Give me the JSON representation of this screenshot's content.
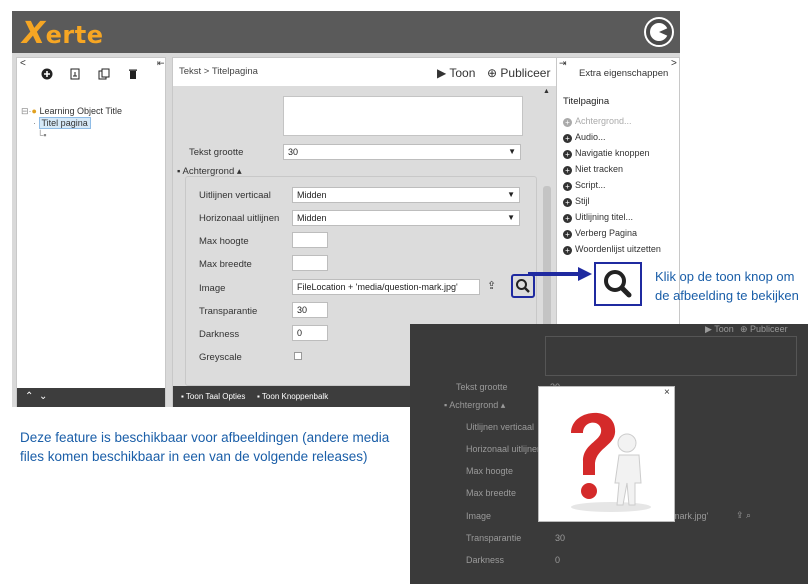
{
  "app": {
    "logo_text": "erte",
    "logo_x": "X",
    "left_toolbar": [
      "+",
      "⎗",
      "⎘",
      "🗑"
    ],
    "tree": {
      "root": "Learning Object Title",
      "selected": "Titel pagina"
    },
    "breadcrumb": "Tekst > Titelpagina",
    "toon": "Toon",
    "publiceer": "Publiceer",
    "tekst_grootte_label": "Tekst grootte",
    "tekst_grootte_value": "30",
    "group_label": "Achtergrond",
    "fields": {
      "uitlijnen_verticaal": {
        "label": "Uitlijnen verticaal",
        "value": "Midden"
      },
      "horizonaal_uitlijnen": {
        "label": "Horizonaal uitlijnen",
        "value": "Midden"
      },
      "max_hoogte": {
        "label": "Max hoogte",
        "value": ""
      },
      "max_breedte": {
        "label": "Max breedte",
        "value": ""
      },
      "image": {
        "label": "Image",
        "value": "FileLocation + 'media/question-mark.jpg'"
      },
      "transparantie": {
        "label": "Transparantie",
        "value": "30"
      },
      "darkness": {
        "label": "Darkness",
        "value": "0"
      },
      "greyscale": {
        "label": "Greyscale"
      }
    },
    "footer": {
      "taal": "Toon Taal Opties",
      "knoppen": "Toon Knoppenbalk"
    },
    "right_panel": {
      "title": "Extra eigenschappen",
      "section": "Titelpagina",
      "props": [
        "Achtergrond...",
        "Audio...",
        "Navigatie knoppen",
        "Niet tracken",
        "Script...",
        "Stijl",
        "Uitlijning titel...",
        "Verberg Pagina",
        "Woordenlijst uitzetten"
      ]
    }
  },
  "annotations": {
    "callout": "Klik op de toon knop om de afbeelding te bekijken",
    "note": "Deze feature is beschikbaar voor afbeeldingen (andere media files komen beschikbaar in een van de volgende releases)"
  },
  "overlay": {
    "toon": "Toon",
    "publiceer": "Publiceer",
    "tekst_grootte": "Tekst grootte",
    "tekst_grootte_value": "30",
    "group_label": "Achtergrond",
    "labels": [
      "Uitlijnen verticaal",
      "Horizonaal uitlijnen",
      "Max hoogte",
      "Max breedte",
      "Image",
      "Transparantie",
      "Darkness"
    ],
    "image_suffix": "mark.jpg'",
    "transparantie_value": "30",
    "darkness_value": "0",
    "modal_close": "×"
  },
  "colors": {
    "accent": "#1f2aa0",
    "annotation_text": "#1a5ea8",
    "logo": "#f6a623"
  }
}
